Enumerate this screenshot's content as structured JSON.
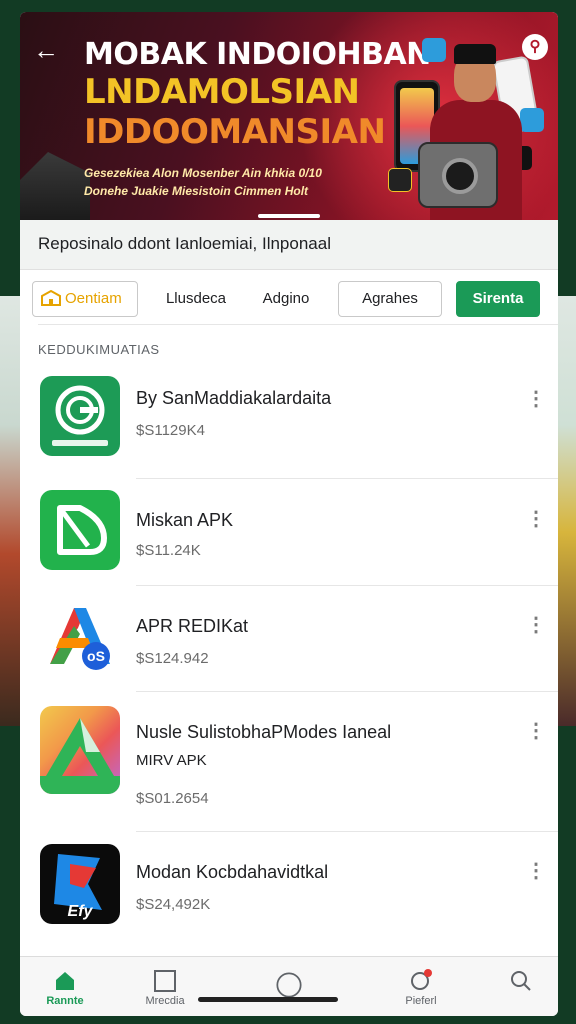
{
  "banner": {
    "headline_lines": [
      "MOBAK INDOIOHBAN",
      "LNDAMOLSIAN",
      "IDDOOMANSIAN"
    ],
    "subline": "Gesezekiea Alon Mosenber Ain khkia 0/10 Donehe Juakie Miesistoin Cimmen Holt"
  },
  "breadcrumb": "Reposinalo ddont Ianloemiai, Ilnponaal",
  "filters": {
    "home_label": "Oentiam",
    "items": [
      "Llusdeca",
      "Adgino",
      "Agrahes"
    ],
    "primary_label": "Sirenta"
  },
  "section_title": "KEDDUKIMUATIAS",
  "apps": [
    {
      "name": "By SanMaddiakalardaita",
      "size": "$S1129K4",
      "icon": "brand-g-icon"
    },
    {
      "name": "Miskan APK",
      "size": "$S11.24K",
      "icon": "green-d-icon"
    },
    {
      "name": "APR REDIKat",
      "size": "$S124.942",
      "icon": "multicolor-a-icon"
    },
    {
      "name": "Nusle SulistobhaPModes Ianeal",
      "sub": "MIRV APK",
      "size": "$S01.2654",
      "icon": "colorful-a-icon"
    },
    {
      "name": "Modan Kocbdahavidtkal",
      "size": "$S24,492K",
      "icon": "flag-e-icon"
    }
  ],
  "bottom_nav": [
    {
      "label": "Rannte",
      "icon": "home-icon",
      "active": true
    },
    {
      "label": "Mrecdia",
      "icon": "square-icon",
      "active": false
    },
    {
      "label": "",
      "icon": "circle-icon",
      "active": false
    },
    {
      "label": "Pieferl",
      "icon": "notification-icon",
      "active": false
    },
    {
      "label": "",
      "icon": "search-icon",
      "active": false
    }
  ],
  "colors": {
    "accent_green": "#1b9a57",
    "banner_red": "#b21a2c",
    "banner_gold": "#f3c326"
  }
}
